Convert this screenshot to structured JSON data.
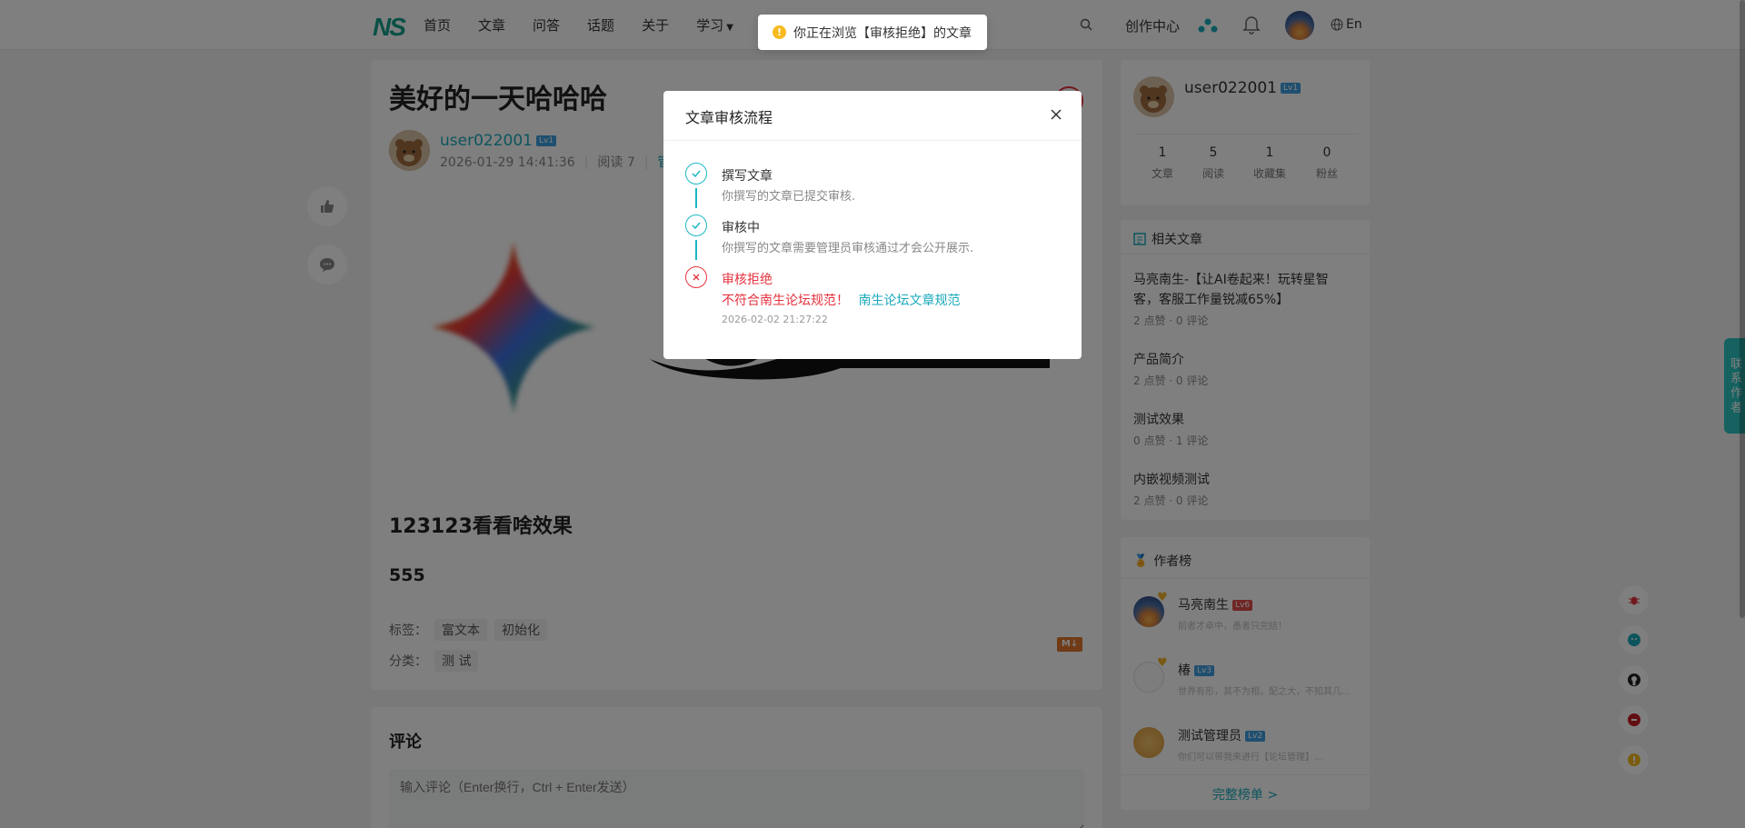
{
  "header": {
    "logo": "NS",
    "nav": [
      "首页",
      "文章",
      "问答",
      "话题",
      "关于",
      "学习"
    ],
    "create_center": "创作中心",
    "lang": "En"
  },
  "article": {
    "title": "美好的一天哈哈哈",
    "author": "user022001",
    "author_level": "Lv1",
    "date": "2026-01-29 14:41:36",
    "reads": "阅读 7",
    "manage": "管理",
    "heading": "123123看看啥效果",
    "paragraph": "555",
    "tags_label": "标签：",
    "tags": [
      "富文本",
      "初始化"
    ],
    "category_label": "分类：",
    "category": "测 试",
    "md_badge": "M↓"
  },
  "comments": {
    "title": "评论",
    "placeholder": "输入评论（Enter换行，Ctrl + Enter发送）"
  },
  "profile": {
    "name": "user022001",
    "level": "Lv1",
    "stats": [
      {
        "value": "1",
        "label": "文章"
      },
      {
        "value": "5",
        "label": "阅读"
      },
      {
        "value": "1",
        "label": "收藏集"
      },
      {
        "value": "0",
        "label": "粉丝"
      }
    ]
  },
  "related": {
    "title": "相关文章",
    "items": [
      {
        "title": "马亮南生-【让AI卷起来！玩转星智客，客服工作量锐减65%】",
        "meta": "2 点赞 · 0 评论"
      },
      {
        "title": "产品简介",
        "meta": "2 点赞 · 0 评论"
      },
      {
        "title": "测试效果",
        "meta": "0 点赞 · 1 评论"
      },
      {
        "title": "内嵌视频测试",
        "meta": "2 点赞 · 0 评论"
      }
    ]
  },
  "ranking": {
    "title": "作者榜",
    "items": [
      {
        "name": "马亮南生",
        "level": "Lv6",
        "desc": "前者才卓中，愚者只完结！"
      },
      {
        "name": "椿",
        "level": "Lv3",
        "desc": "世界有形，其不为相，配之大，不知其几..."
      },
      {
        "name": "测试管理员",
        "level": "Lv2",
        "desc": "你们可以带我来进行【论坛管理】..."
      }
    ],
    "full_link": "完整榜单 >"
  },
  "contact": "联系作者",
  "toast": {
    "text": "你正在浏览【审核拒绝】的文章"
  },
  "modal": {
    "title": "文章审核流程",
    "steps": [
      {
        "title": "撰写文章",
        "desc": "你撰写的文章已提交审核."
      },
      {
        "title": "审核中",
        "desc": "你撰写的文章需要管理员审核通过才会公开展示."
      },
      {
        "title": "审核拒绝",
        "reason": "不符合南生论坛规范！",
        "link": "南生论坛文章规范",
        "time": "2026-02-02 21:27:22"
      }
    ]
  },
  "colors": {
    "accent": "#1baabb",
    "error": "#e5323e",
    "brand": "#12a18a",
    "warn": "#f7ba1e"
  }
}
